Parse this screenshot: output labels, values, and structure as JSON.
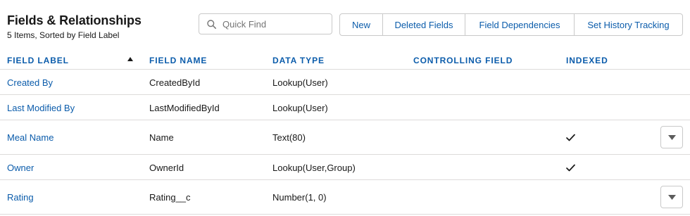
{
  "header": {
    "title": "Fields & Relationships",
    "subtitle": "5 Items, Sorted by Field Label"
  },
  "search": {
    "placeholder": "Quick Find",
    "icon": "search-icon"
  },
  "buttons": {
    "new": "New",
    "deleted_fields": "Deleted Fields",
    "field_dependencies": "Field Dependencies",
    "set_history_tracking": "Set History Tracking"
  },
  "table": {
    "columns": {
      "field_label": "FIELD LABEL",
      "field_name": "FIELD NAME",
      "data_type": "DATA TYPE",
      "controlling_field": "CONTROLLING FIELD",
      "indexed": "INDEXED"
    },
    "sort": {
      "column": "field_label",
      "direction": "ascending",
      "icon": "sort-up-icon"
    },
    "rows": [
      {
        "label": "Created By",
        "name": "CreatedById",
        "type": "Lookup(User)",
        "controlling": "",
        "indexed": false,
        "has_menu": false
      },
      {
        "label": "Last Modified By",
        "name": "LastModifiedById",
        "type": "Lookup(User)",
        "controlling": "",
        "indexed": false,
        "has_menu": false
      },
      {
        "label": "Meal Name",
        "name": "Name",
        "type": "Text(80)",
        "controlling": "",
        "indexed": true,
        "has_menu": true
      },
      {
        "label": "Owner",
        "name": "OwnerId",
        "type": "Lookup(User,Group)",
        "controlling": "",
        "indexed": true,
        "has_menu": false
      },
      {
        "label": "Rating",
        "name": "Rating__c",
        "type": "Number(1, 0)",
        "controlling": "",
        "indexed": false,
        "has_menu": true
      }
    ]
  },
  "colors": {
    "link": "#0b5cab",
    "border": "#dddbda",
    "text": "#181818"
  }
}
